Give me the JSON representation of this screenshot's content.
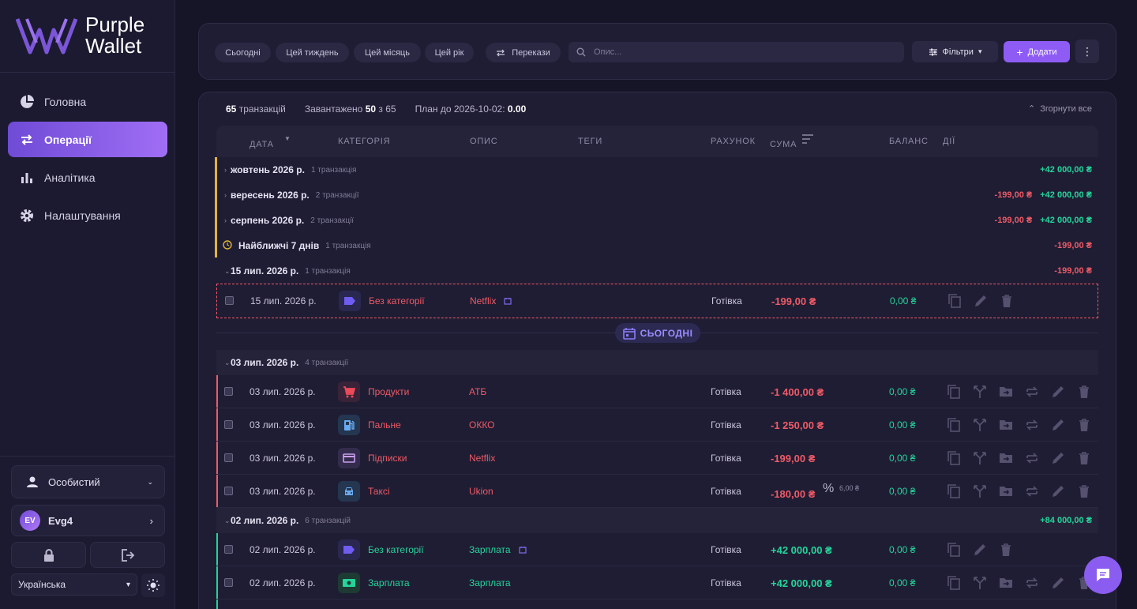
{
  "brand": {
    "line1": "Purple",
    "line2": "Wallet"
  },
  "nav": [
    {
      "label": "Головна",
      "icon": "pie-chart-icon"
    },
    {
      "label": "Операції",
      "icon": "swap-icon",
      "active": true
    },
    {
      "label": "Аналітика",
      "icon": "bar-chart-icon"
    },
    {
      "label": "Налаштування",
      "icon": "gear-icon"
    }
  ],
  "sidebar": {
    "profile": "Особистий",
    "user_initials": "EV",
    "user_name": "Evg4",
    "language": "Українська"
  },
  "filters": {
    "periods": [
      "Сьогодні",
      "Цей тиждень",
      "Цей місяць",
      "Цей рік"
    ],
    "transfers": "Перекази",
    "search_placeholder": "Опис...",
    "filters_label": "Фільтри",
    "add_label": "Додати"
  },
  "summary": {
    "count_num": "65",
    "count_label": "транзакцій",
    "loaded_prefix": "Завантажено",
    "loaded_num": "50",
    "loaded_suffix": "з 65",
    "plan_label": "План до 2026-10-02:",
    "plan_value": "0.00",
    "collapse_all": "Згорнути все"
  },
  "columns": {
    "date": "ДАТА",
    "category": "КАТЕГОРІЯ",
    "description": "ОПИС",
    "tags": "ТЕГИ",
    "account": "РАХУНОК",
    "amount": "СУМА",
    "balance": "БАЛАНС",
    "actions": "ДІЇ"
  },
  "groups": {
    "oct": {
      "title": "жовтень 2026 р.",
      "count": "1 транзакція",
      "income": "+42 000,00 ₴"
    },
    "sep": {
      "title": "вересень 2026 р.",
      "count": "2 транзакції",
      "expense": "-199,00 ₴",
      "income": "+42 000,00 ₴"
    },
    "aug": {
      "title": "серпень 2026 р.",
      "count": "2 транзакції",
      "expense": "-199,00 ₴",
      "income": "+42 000,00 ₴"
    },
    "next7": {
      "title": "Найближчі 7 днів",
      "count": "1 транзакція",
      "expense": "-199,00 ₴"
    },
    "jul15": {
      "title": "15 лип. 2026 р.",
      "count": "1 транзакція",
      "expense": "-199,00 ₴"
    },
    "jul03": {
      "title": "03 лип. 2026 р.",
      "count": "4 транзакції"
    },
    "jul02": {
      "title": "02 лип. 2026 р.",
      "count": "6 транзакцій",
      "income": "+84 000,00 ₴"
    }
  },
  "today_label": "СЬОГОДНІ",
  "transactions": [
    {
      "date": "15 лип. 2026 р.",
      "category": "Без категорії",
      "description": "Netflix",
      "account": "Готівка",
      "amount": "-199,00 ₴",
      "balance": "0,00 ₴",
      "icon": "tag-icon",
      "color": "#6f5cf0"
    },
    {
      "date": "03 лип. 2026 р.",
      "category": "Продукти",
      "description": "АТБ",
      "account": "Готівка",
      "amount": "-1 400,00 ₴",
      "balance": "0,00 ₴",
      "icon": "cart-icon",
      "color": "#ee4a5a"
    },
    {
      "date": "03 лип. 2026 р.",
      "category": "Пальне",
      "description": "ОККО",
      "account": "Готівка",
      "amount": "-1 250,00 ₴",
      "balance": "0,00 ₴",
      "icon": "fuel-icon",
      "color": "#6aaaf0"
    },
    {
      "date": "03 лип. 2026 р.",
      "category": "Підписки",
      "description": "Netflix",
      "account": "Готівка",
      "amount": "-199,00 ₴",
      "balance": "0,00 ₴",
      "icon": "card-icon",
      "color": "#c9a0f0"
    },
    {
      "date": "03 лип. 2026 р.",
      "category": "Таксі",
      "description": "Ukion",
      "account": "Готівка",
      "amount": "-180,00 ₴",
      "balance": "0,00 ₴",
      "icon": "car-icon",
      "color": "#6aaaf0",
      "fee": "6,00 ₴"
    },
    {
      "date": "02 лип. 2026 р.",
      "category": "Без категорії",
      "description": "Зарплата",
      "account": "Готівка",
      "amount": "+42 000,00 ₴",
      "balance": "0,00 ₴",
      "icon": "tag-icon",
      "color": "#6f5cf0"
    },
    {
      "date": "02 лип. 2026 р.",
      "category": "Зарплата",
      "description": "Зарплата",
      "account": "Готівка",
      "amount": "+42 000,00 ₴",
      "balance": "0,00 ₴",
      "icon": "money-icon",
      "color": "#25d49a"
    }
  ]
}
